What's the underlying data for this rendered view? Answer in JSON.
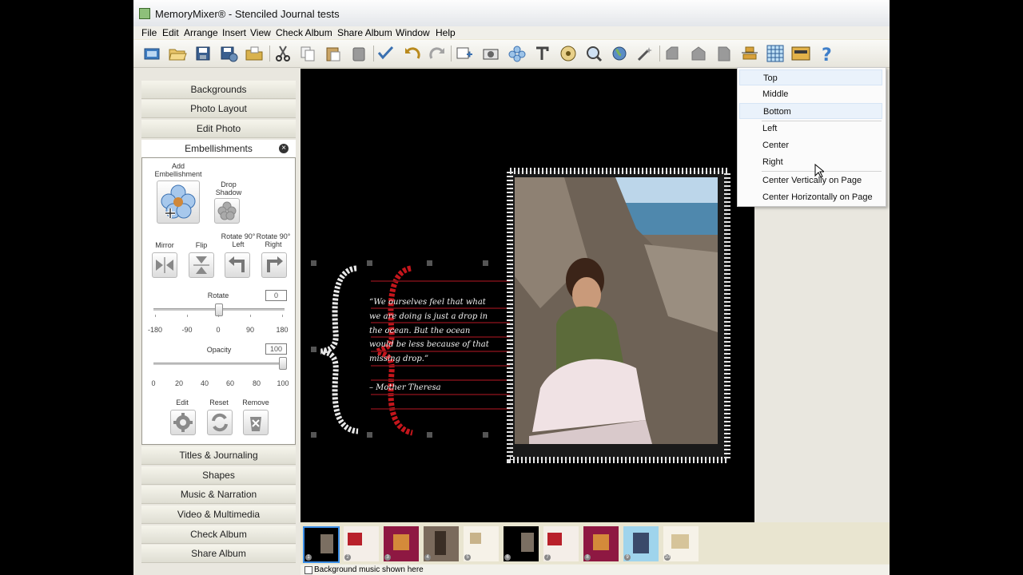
{
  "window": {
    "title": "MemoryMixer® - Stenciled Journal tests"
  },
  "menu": [
    "File",
    "Edit",
    "Arrange",
    "Insert",
    "View",
    "Check Album",
    "Share Album",
    "Window",
    "Help"
  ],
  "toolbar_icons": [
    "new-album-icon",
    "open-icon",
    "save-icon",
    "save-as-icon",
    "open-folder-icon",
    "cut-icon",
    "copy-icon",
    "paste-icon",
    "delete-icon",
    "spell-check-icon",
    "undo-icon",
    "redo-icon",
    "add-photo-icon",
    "camera-icon",
    "embellishment-icon",
    "add-text-icon",
    "film-reel-icon",
    "zoom-icon",
    "globe-icon",
    "magic-icon",
    "bring-forward-icon",
    "send-back-icon",
    "page-icon",
    "align-icon",
    "grid-icon",
    "layout-icon",
    "help-icon"
  ],
  "left_panel": {
    "sections_top": [
      "Backgrounds",
      "Photo Layout",
      "Edit Photo"
    ],
    "embellishments": {
      "header": "Embellishments",
      "add_label": "Add Embellishment",
      "drop_shadow_label": "Drop Shadow",
      "mirror_label": "Mirror",
      "flip_label": "Flip",
      "rotate_left_label": "Rotate 90° Left",
      "rotate_right_label": "Rotate 90° Right",
      "rotate_label": "Rotate",
      "rotate_value": "0",
      "rotate_ticks": [
        "-180",
        "-90",
        "0",
        "90",
        "180"
      ],
      "opacity_label": "Opacity",
      "opacity_value": "100",
      "opacity_ticks": [
        "0",
        "20",
        "40",
        "60",
        "80",
        "100"
      ],
      "edit_label": "Edit",
      "reset_label": "Reset",
      "remove_label": "Remove"
    },
    "sections_bottom": [
      "Titles & Journaling",
      "Shapes",
      "Music & Narration",
      "Video & Multimedia",
      "Check Album",
      "Share Album"
    ]
  },
  "canvas": {
    "quote_lines": [
      "“We ourselves feel that what",
      "we are doing is just a drop in",
      "the ocean. But the ocean",
      "would be less because of that",
      "missing drop.”",
      "– Mother Theresa"
    ]
  },
  "align_menu": {
    "items": [
      "Top",
      "Middle",
      "Bottom",
      "Left",
      "Center",
      "Right",
      "Center Vertically on Page",
      "Center Horizontally on Page"
    ]
  },
  "filmstrip": {
    "pages": [
      "1",
      "2",
      "3",
      "4",
      "5",
      "6",
      "7",
      "8",
      "9",
      "10"
    ]
  },
  "status": {
    "text": "Background music shown here"
  }
}
